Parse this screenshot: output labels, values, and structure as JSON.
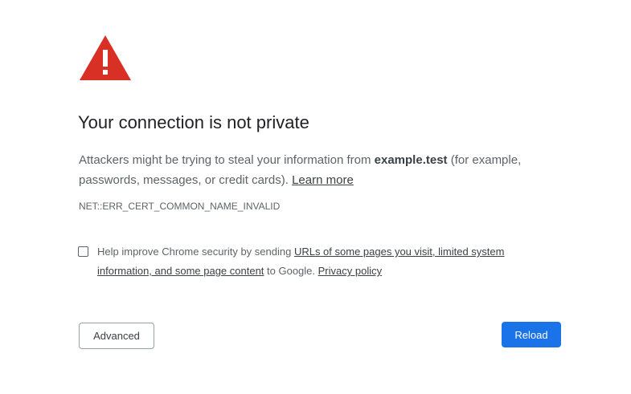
{
  "page": {
    "title": "Your connection is not private",
    "icon": "warning-triangle-icon",
    "accent_color": "#d93025"
  },
  "description": {
    "text_before": "Attackers might be trying to steal your information from ",
    "domain": "example.test",
    "text_after": " (for example, passwords, messages, or credit cards). ",
    "learn_more_label": "Learn more"
  },
  "error_code": "NET::ERR_CERT_COMMON_NAME_INVALID",
  "optin": {
    "checked": false,
    "text_before": "Help improve Chrome security by sending ",
    "link_label": "URLs of some pages you visit, limited system information, and some page content",
    "text_middle": " to Google. ",
    "privacy_label": "Privacy policy"
  },
  "buttons": {
    "advanced_label": "Advanced",
    "reload_label": "Reload",
    "reload_color": "#1a73e8"
  }
}
